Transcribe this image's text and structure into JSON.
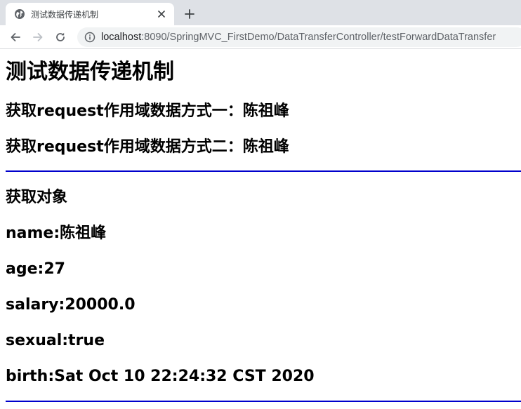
{
  "browser": {
    "tab": {
      "title": "测试数据传递机制",
      "close_symbol": "✕",
      "favicon": "globe-icon"
    },
    "new_tab_symbol": "+",
    "nav": {
      "back_icon": "back-arrow-icon",
      "forward_icon": "forward-arrow-icon",
      "reload_icon": "reload-icon"
    },
    "address": {
      "host": "localhost",
      "rest": ":8090/SpringMVC_FirstDemo/DataTransferController/testForwardDataTransfer",
      "info_icon": "info-icon"
    }
  },
  "page": {
    "title": "测试数据传递机制",
    "request_scope": {
      "way_one": "获取request作用域数据方式一：陈祖峰",
      "way_two": "获取request作用域数据方式二：陈祖峰"
    },
    "object_section": {
      "heading": "获取对象",
      "name": "name:陈祖峰",
      "age": "age:27",
      "salary": "salary:20000.0",
      "sexual": "sexual:true",
      "birth": "birth:Sat Oct 10 22:24:32 CST 2020"
    }
  },
  "colors": {
    "divider": "#0000cc",
    "tabstrip": "#dee1e6",
    "omnibox": "#f1f3f4"
  }
}
